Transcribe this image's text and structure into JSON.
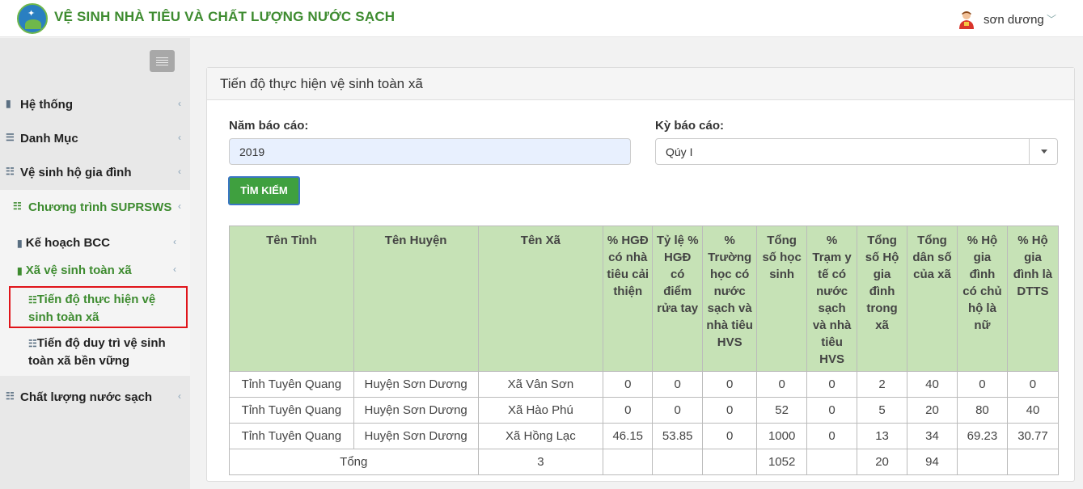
{
  "header": {
    "app_title": "VỆ SINH NHÀ TIÊU VÀ CHẤT LƯỢNG NƯỚC SẠCH",
    "user_name": "sơn dương",
    "user_caret": "﹀"
  },
  "sidebar": {
    "items": [
      {
        "label": "Hệ thống",
        "icon": "file-icon"
      },
      {
        "label": "Danh Mục",
        "icon": "list-icon"
      },
      {
        "label": "Vệ sinh hộ gia đình",
        "icon": "server-icon"
      },
      {
        "label": "Chương trình SUPRSWS",
        "icon": "server-icon"
      },
      {
        "label": "Chất lượng nước sạch",
        "icon": "server-icon"
      }
    ],
    "sub_items": {
      "ke_hoach": "Kế hoạch BCC",
      "xa_ve_sinh": "Xã vệ sinh toàn xã",
      "tien_do_thuc_hien_1": "Tiến độ thực hiện vệ",
      "tien_do_thuc_hien_2": "sinh toàn xã",
      "tien_do_duy_tri_1": "Tiến độ duy trì vệ sinh",
      "tien_do_duy_tri_2": "toàn xã bền vững"
    }
  },
  "main": {
    "title": "Tiến độ thực hiện vệ sinh toàn xã",
    "year_label": "Năm báo cáo:",
    "year_value": "2019",
    "period_label": "Kỳ báo cáo:",
    "period_value": "Qúy I",
    "search_button": "TÌM KIẾM"
  },
  "table": {
    "headers": [
      "Tên Tỉnh",
      "Tên Huyện",
      "Tên Xã",
      "% HGĐ có nhà tiêu cải thiện",
      "Tỷ lệ % HGĐ có điểm rửa tay",
      "% Trường học có nước sạch và nhà tiêu HVS",
      "Tổng số học sinh",
      "% Trạm y tế có nước sạch và nhà tiêu HVS",
      "Tổng số Hộ gia đình trong xã",
      "Tổng dân số của xã",
      "% Hộ gia đình có chủ hộ là nữ",
      "% Hộ gia đình là DTTS"
    ],
    "rows": [
      [
        "Tỉnh Tuyên Quang",
        "Huyện Sơn Dương",
        "Xã Vân Sơn",
        "0",
        "0",
        "0",
        "0",
        "0",
        "2",
        "40",
        "0",
        "0"
      ],
      [
        "Tỉnh Tuyên Quang",
        "Huyện Sơn Dương",
        "Xã Hào Phú",
        "0",
        "0",
        "0",
        "52",
        "0",
        "5",
        "20",
        "80",
        "40"
      ],
      [
        "Tỉnh Tuyên Quang",
        "Huyện Sơn Dương",
        "Xã Hồng Lạc",
        "46.15",
        "53.85",
        "0",
        "1000",
        "0",
        "13",
        "34",
        "69.23",
        "30.77"
      ]
    ],
    "total": {
      "label": "Tổng",
      "xa_count": "3",
      "cells": [
        "",
        "",
        "",
        "1052",
        "",
        "20",
        "94",
        "",
        ""
      ]
    }
  }
}
